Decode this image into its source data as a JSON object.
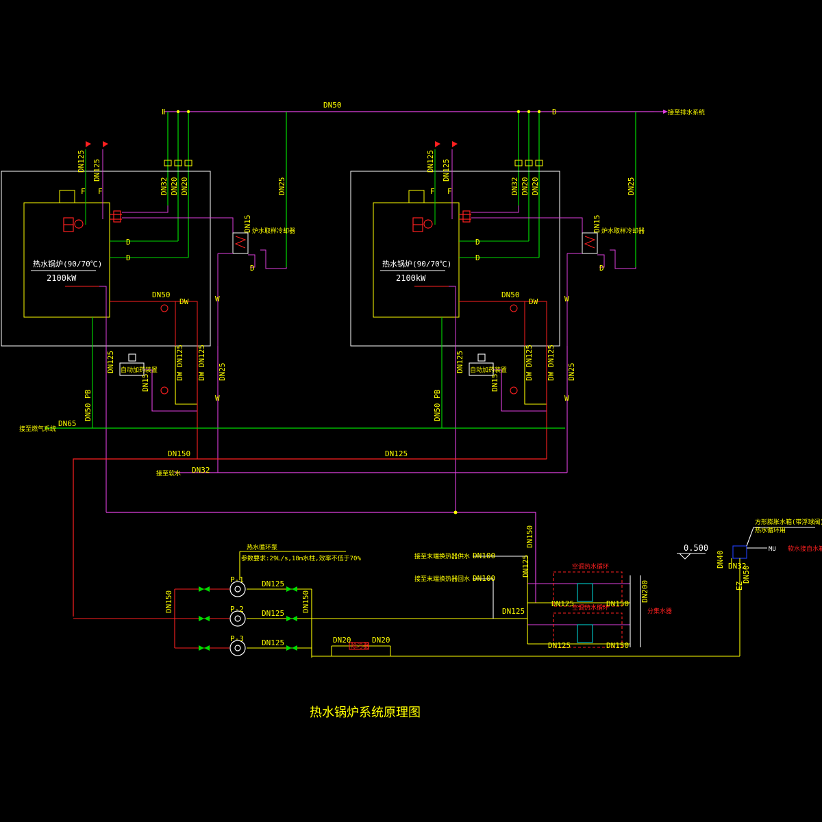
{
  "title": "热水锅炉系统原理图",
  "colors": {
    "background": "#000000",
    "magenta": "#e040e0",
    "green": "#00dd00",
    "yellow": "#ffff00",
    "red": "#ff2020",
    "white": "#ffffff",
    "cyan": "#00e0e0",
    "blue": "#2040ff"
  },
  "top": {
    "main_pipe": "DN50",
    "to_drain": "接至排水系统",
    "d_mark": "D"
  },
  "boiler_left": {
    "name": "热水锅炉(90/70℃)",
    "power": "2100kW",
    "supply_dn_a": "DN125",
    "supply_dn_b": "DN125",
    "f_a": "F",
    "f_b": "F",
    "drain_dn_a": "DN32",
    "drain_dn_b": "DN20",
    "drain_dn_c": "DN20",
    "overflow_dn": "DN25",
    "cooler_dn": "DN15",
    "cooler_name": "炉水取样冷却器",
    "d1": "D",
    "d2": "D",
    "d3": "D",
    "blowdown_dn": "DN50",
    "dw": "DW",
    "w": "W"
  },
  "boiler_right": {
    "name": "热水锅炉(90/70℃)",
    "power": "2100kW",
    "supply_dn_a": "DN125",
    "supply_dn_b": "DN125",
    "f_a": "F",
    "f_b": "F",
    "drain_dn_a": "DN32",
    "drain_dn_b": "DN20",
    "drain_dn_c": "DN20",
    "overflow_dn": "DN25",
    "cooler_dn": "DN15",
    "cooler_name": "炉水取样冷却器",
    "d1": "D",
    "d2": "D",
    "d3": "D",
    "blowdown_dn": "DN50",
    "dw": "DW",
    "w": "W"
  },
  "below_boilers": {
    "left_dn125": "DN125",
    "left_dn15": "DN15",
    "left_dw_dn125_a": "DW DN125",
    "left_dw_dn125_b": "DW DN125",
    "left_dn25": "DN25",
    "left_w": "W",
    "left_dn50_pb": "DN50 PB",
    "left_doser": "自动加药装置",
    "right_dn125": "DN125",
    "right_dn15": "DN15",
    "right_dw_dn125_a": "DW DN125",
    "right_dw_dn125_b": "DW DN125",
    "right_dn25": "DN25",
    "right_w": "W",
    "right_dn50_pb": "DN50 PB",
    "right_doser": "自动加药装置"
  },
  "headers": {
    "gas_label": "接至燃气系统",
    "gas_dn": "DN65",
    "dn150": "DN150",
    "dn125": "DN125",
    "softwater_label": "接至软水",
    "softwater_dn": "DN32"
  },
  "pumps": {
    "title": "热水循环泵",
    "spec": "参数要求:29L/s,18m水柱,效率不低于70%",
    "p1": "P-1",
    "p2": "P-2",
    "p3": "P-3",
    "dn125_a": "DN125",
    "dn125_b": "DN125",
    "dn125_c": "DN125",
    "dn150_left": "DN150",
    "dn150_right": "DN150",
    "bypass_a": "DN20",
    "bypass_b": "DN20",
    "bypass_dev": "除污器"
  },
  "hx": {
    "dn150_vert": "DN150",
    "dn125_vert": "DN125",
    "supply_label": "接至末端换热器供水",
    "return_label": "接至末端换热器回水",
    "dn100_a": "DN100",
    "dn100_b": "DN100",
    "dn125_mid": "DN125",
    "hx1_label": "空调热水循环",
    "hx2_label": "空调热水循环",
    "dn125_a": "DN125",
    "dn150_a": "DN150",
    "dn125_b": "DN125",
    "dn150_b": "DN150",
    "dn200": "DN200",
    "collector": "分集水器"
  },
  "tank": {
    "level": "0.500",
    "label_a": "方形膨胀水箱(带浮球阀)",
    "label_b": "热水循环用",
    "mu": "MU",
    "dn40": "DN40",
    "dn32": "DN32",
    "dn50": "DN50",
    "ez": "EZ",
    "softwater": "软水接自水箱"
  }
}
